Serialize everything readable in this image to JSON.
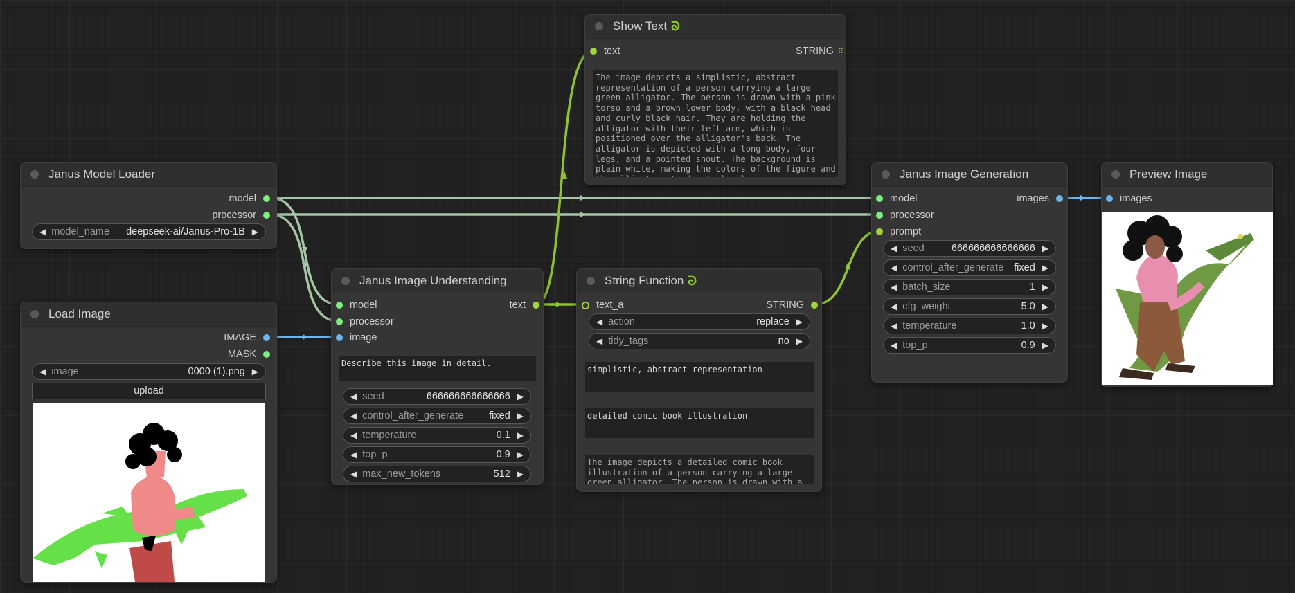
{
  "colors": {
    "model_link": "#a7c5a7",
    "image_link": "#6cb6f0",
    "string_link": "#8fc132"
  },
  "nodes": {
    "model_loader": {
      "title": "Janus Model Loader",
      "outputs": [
        "model",
        "processor"
      ],
      "widgets": [
        {
          "label": "model_name",
          "value": "deepseek-ai/Janus-Pro-1B"
        }
      ]
    },
    "load_image": {
      "title": "Load Image",
      "outputs": [
        "IMAGE",
        "MASK"
      ],
      "widgets": [
        {
          "label": "image",
          "value": "0000 (1).png"
        }
      ],
      "upload_label": "upload"
    },
    "understanding": {
      "title": "Janus Image Understanding",
      "inputs": [
        "model",
        "processor",
        "image"
      ],
      "outputs": [
        "text"
      ],
      "question": "Describe this image in detail.",
      "widgets": [
        {
          "label": "seed",
          "value": "666666666666666"
        },
        {
          "label": "control_after_generate",
          "value": "fixed"
        },
        {
          "label": "temperature",
          "value": "0.1"
        },
        {
          "label": "top_p",
          "value": "0.9"
        },
        {
          "label": "max_new_tokens",
          "value": "512"
        }
      ]
    },
    "show_text": {
      "title": "Show Text",
      "title_icon": "python-snake-icon",
      "inputs": [
        "text"
      ],
      "outputs": [
        "STRING"
      ],
      "content": "The image depicts a simplistic, abstract representation of a person carrying a large green alligator. The person is drawn with a pink torso and a brown lower body, with a black head and curly black hair. They are holding the alligator with their left arm, which is positioned over the alligator's back. The alligator is depicted with a long body, four legs, and a pointed snout. The background is plain white, making the colors of the figure and the alligator stand out clearly."
    },
    "string_function": {
      "title": "String Function",
      "title_icon": "python-snake-icon",
      "inputs": [
        "text_a"
      ],
      "outputs": [
        "STRING"
      ],
      "widgets": [
        {
          "label": "action",
          "value": "replace"
        },
        {
          "label": "tidy_tags",
          "value": "no"
        }
      ],
      "text_b": "simplistic, abstract representation",
      "text_c": "detailed comic book illustration",
      "result": "The image depicts a detailed comic book illustration of a person carrying a large green alligator. The person is drawn with a"
    },
    "generation": {
      "title": "Janus Image Generation",
      "inputs": [
        "model",
        "processor",
        "prompt"
      ],
      "outputs": [
        "images"
      ],
      "widgets": [
        {
          "label": "seed",
          "value": "666666666666666"
        },
        {
          "label": "control_after_generate",
          "value": "fixed"
        },
        {
          "label": "batch_size",
          "value": "1"
        },
        {
          "label": "cfg_weight",
          "value": "5.0"
        },
        {
          "label": "temperature",
          "value": "1.0"
        },
        {
          "label": "top_p",
          "value": "0.9"
        }
      ]
    },
    "preview": {
      "title": "Preview Image",
      "inputs": [
        "images"
      ]
    }
  }
}
